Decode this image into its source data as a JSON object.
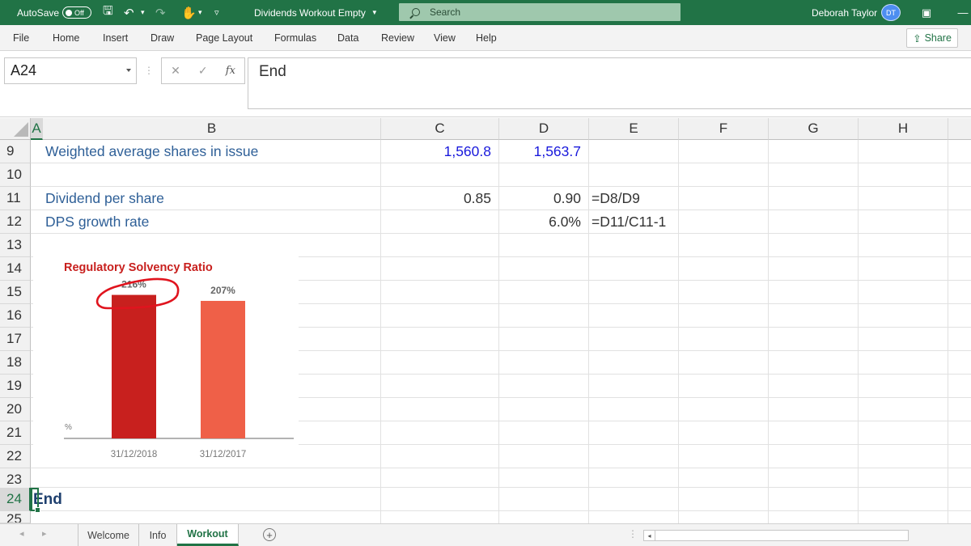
{
  "titlebar": {
    "autosave_label": "AutoSave",
    "autosave_state": "Off",
    "document_title": "Dividends Workout Empty",
    "search_placeholder": "Search",
    "user_name": "Deborah Taylor",
    "user_initials": "DT"
  },
  "ribbon": {
    "tabs": [
      "File",
      "Home",
      "Insert",
      "Draw",
      "Page Layout",
      "Formulas",
      "Data",
      "Review",
      "View",
      "Help"
    ],
    "share_label": "Share"
  },
  "formula_bar": {
    "name_box": "A24",
    "fx_label": "fx",
    "content": "End"
  },
  "grid": {
    "columns": [
      "A",
      "B",
      "C",
      "D",
      "E",
      "F",
      "G",
      "H"
    ],
    "rows": [
      "9",
      "10",
      "11",
      "12",
      "13",
      "14",
      "15",
      "16",
      "17",
      "18",
      "19",
      "20",
      "21",
      "22",
      "23",
      "24",
      "25"
    ],
    "cells": {
      "b9": "Weighted average shares in issue",
      "c9": "1,560.8",
      "d9": "1,563.7",
      "b11": "Dividend per share",
      "c11": "0.85",
      "d11": "0.90",
      "e11": "=D8/D9",
      "b12": "DPS growth rate",
      "d12": "6.0%",
      "e12": "=D11/C11-1",
      "a24": "End"
    }
  },
  "chart_data": {
    "type": "bar",
    "title": "Regulatory Solvency Ratio",
    "categories": [
      "31/12/2018",
      "31/12/2017"
    ],
    "values": [
      216,
      207
    ],
    "data_labels": [
      "216%",
      "207%"
    ],
    "ylabel": "%",
    "colors": [
      "#c8201e",
      "#ef6048"
    ],
    "annotation_color": "#e0141e"
  },
  "sheets": {
    "tabs": [
      "Welcome",
      "Info",
      "Workout"
    ],
    "active": "Workout"
  }
}
